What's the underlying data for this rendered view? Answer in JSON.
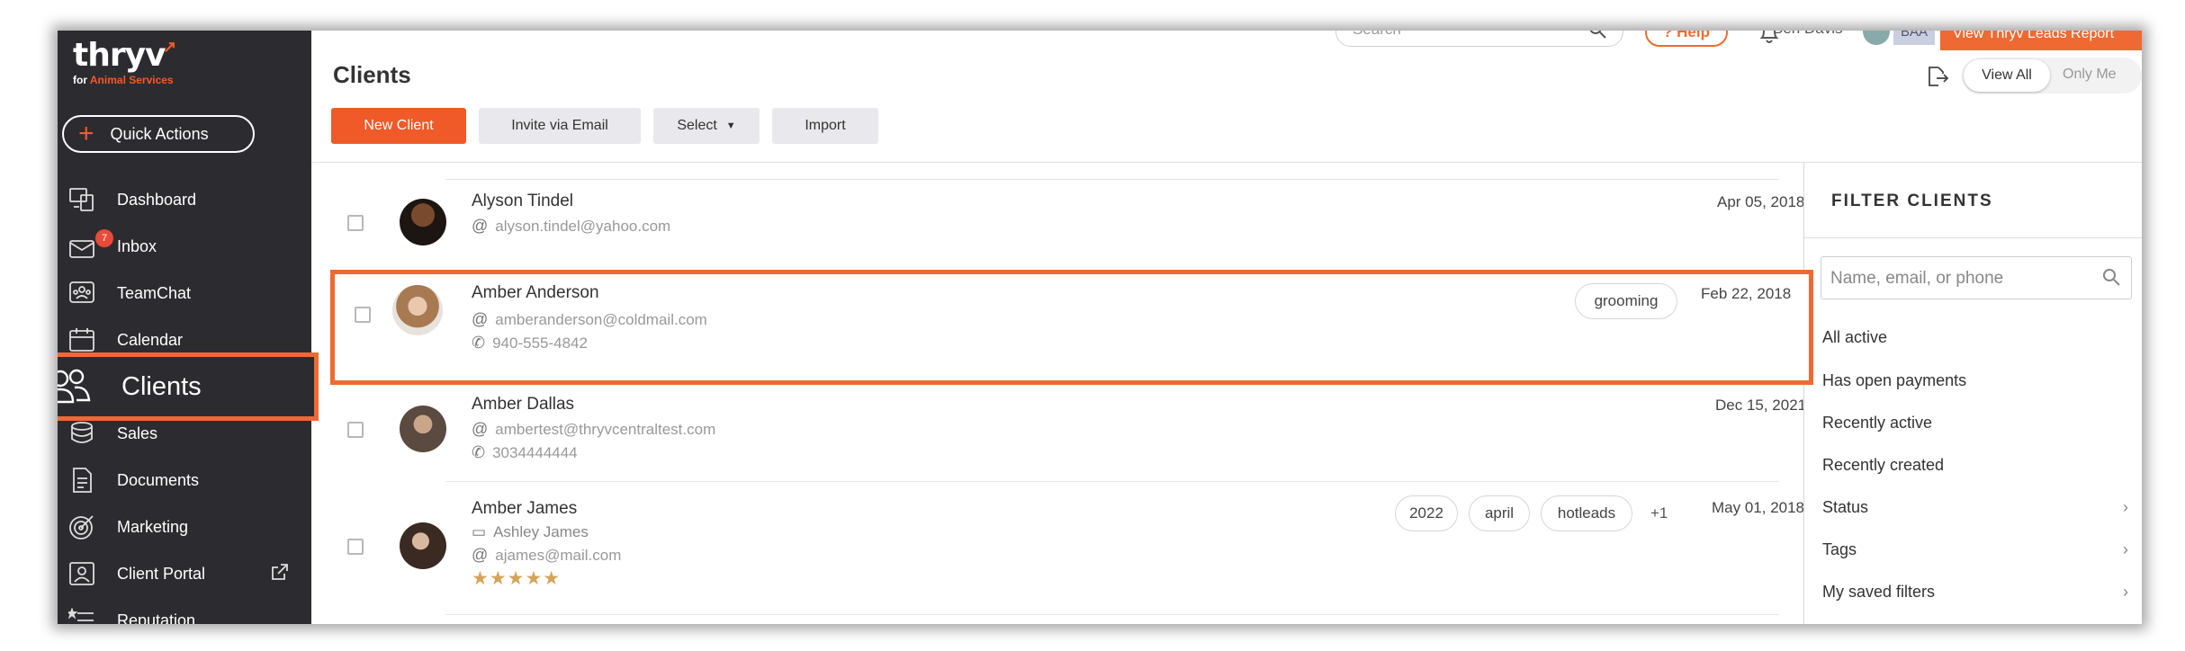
{
  "sidebar": {
    "logo": {
      "word": "thryv",
      "sub_prefix": "for",
      "sub_accent": "Animal Services"
    },
    "quick_actions": "Quick Actions",
    "items": [
      {
        "label": "Dashboard",
        "icon": "dashboard-icon"
      },
      {
        "label": "Inbox",
        "icon": "inbox-icon",
        "badge": "7"
      },
      {
        "label": "TeamChat",
        "icon": "teamchat-icon"
      },
      {
        "label": "Calendar",
        "icon": "calendar-icon"
      },
      {
        "label": "Clients",
        "icon": "clients-icon"
      },
      {
        "label": "Sales",
        "icon": "sales-icon"
      },
      {
        "label": "Documents",
        "icon": "documents-icon"
      },
      {
        "label": "Marketing",
        "icon": "marketing-icon"
      },
      {
        "label": "Client Portal",
        "icon": "client-portal-icon",
        "external": "external-link-icon"
      },
      {
        "label": "Reputation",
        "icon": "reputation-icon"
      }
    ]
  },
  "header": {
    "search_placeholder": "Search",
    "help": "? Help",
    "user_name": "Ben Davis",
    "initials": "BAA",
    "leads_report": "View Thryv Leads Report",
    "page_title": "Clients",
    "view_all": "View All",
    "only_me": "Only Me"
  },
  "toolbar": {
    "new_client": "New Client",
    "invite": "Invite via Email",
    "select": "Select",
    "import": "Import"
  },
  "clients": [
    {
      "name": "Alyson Tindel",
      "email": "alyson.tindel@yahoo.com",
      "date": "Apr 05, 2018"
    },
    {
      "name": "Amber Anderson",
      "email": "amberanderson@coldmail.com",
      "phone": "940-555-4842",
      "date": "Feb 22, 2018",
      "tags": [
        "grooming"
      ]
    },
    {
      "name": "Amber Dallas",
      "email": "ambertest@thryvcentraltest.com",
      "phone": "3034444444",
      "date": "Dec 15, 2021"
    },
    {
      "name": "Amber James",
      "contact": "Ashley James",
      "email": "ajames@mail.com",
      "date": "May 01, 2018",
      "tags": [
        "2022",
        "april",
        "hotleads"
      ],
      "more": "+1",
      "stars": "★★★★★",
      "rating": 5
    }
  ],
  "filter": {
    "title": "FILTER CLIENTS",
    "search_placeholder": "Name, email, or phone",
    "items": [
      "All active",
      "Has open payments",
      "Recently active",
      "Recently created",
      "Status",
      "Tags",
      "My saved filters"
    ]
  },
  "colors": {
    "accent": "#ef5a28",
    "sidebar_bg": "#2c2c30",
    "highlight": "#ef6a32",
    "star": "#d4a45a"
  }
}
